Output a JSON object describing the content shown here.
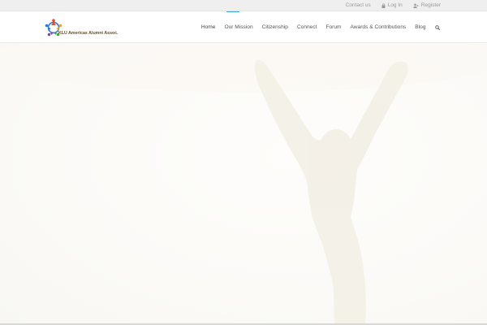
{
  "topbar": {
    "links": [
      {
        "label": "Contact us",
        "icon": ""
      },
      {
        "label": "Log In",
        "icon": "lock-icon"
      },
      {
        "label": "Register",
        "icon": "user-plus-icon"
      }
    ]
  },
  "header": {
    "logo_text": "KLU Americas Alumni Assoc.",
    "nav": [
      {
        "label": "Home",
        "active": true
      },
      {
        "label": "Our Mission"
      },
      {
        "label": "Citizenship"
      },
      {
        "label": "Connect"
      },
      {
        "label": "Forum"
      },
      {
        "label": "Awards & Contributions"
      },
      {
        "label": "Blog"
      }
    ],
    "search_icon": "search-icon",
    "accent_color": "#3fa8dc"
  }
}
